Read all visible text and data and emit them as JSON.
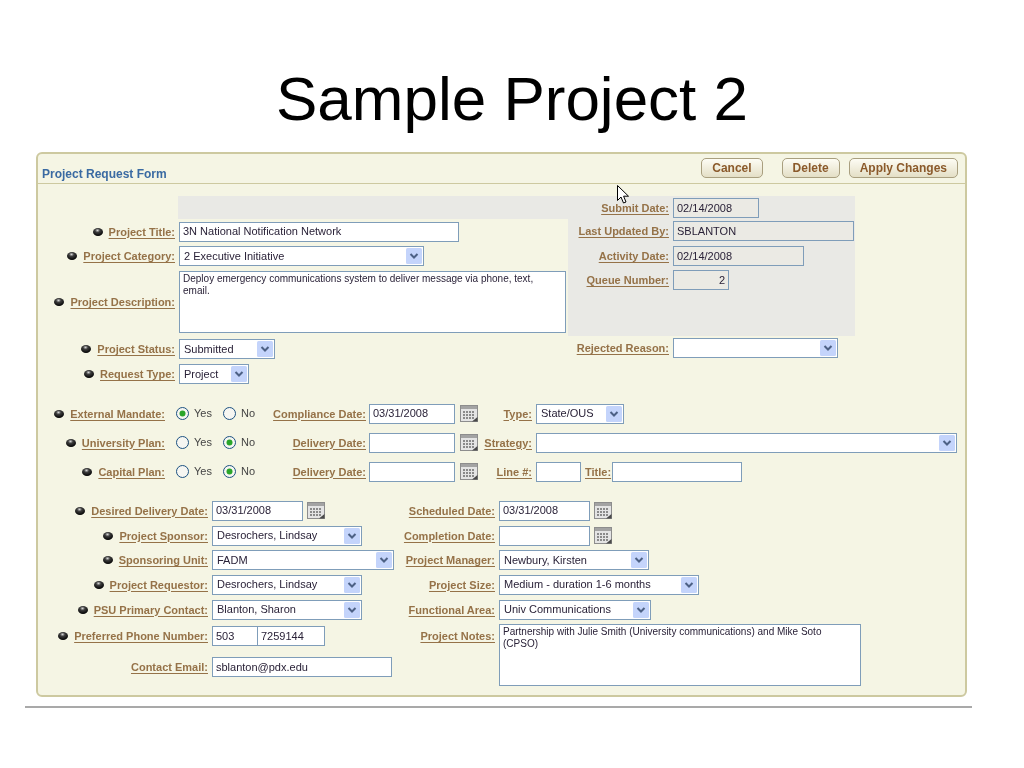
{
  "slide_title": "Sample Project 2",
  "form": {
    "title": "Project Request Form",
    "buttons": [
      "Cancel",
      "Delete",
      "Apply Changes"
    ],
    "project_fields": [
      {
        "label": "Project Title:",
        "kind": "text",
        "value": "3N National Notification Network",
        "required": true
      },
      {
        "label": "Project Category:",
        "kind": "select",
        "value": "2 Executive Initiative",
        "required": true
      },
      {
        "label": "Project Description:",
        "kind": "textarea",
        "value": "Deploy emergency communications system to deliver message via phone, text, email.",
        "required": true
      },
      {
        "label": "Project Status:",
        "kind": "select",
        "value": "Submitted",
        "required": true
      },
      {
        "label": "Request Type:",
        "kind": "select",
        "value": "Project",
        "required": true
      }
    ],
    "tracking_fields": [
      {
        "label": "Submit Date:",
        "kind": "text",
        "value": "02/14/2008",
        "readonly": true
      },
      {
        "label": "Last Updated By:",
        "kind": "text",
        "value": "SBLANTON",
        "readonly": true
      },
      {
        "label": "Activity Date:",
        "kind": "text",
        "value": "02/14/2008",
        "readonly": true
      },
      {
        "label": "Queue Number:",
        "kind": "number",
        "value": "2",
        "readonly": true
      },
      {
        "label": "Rejected Reason:",
        "kind": "select",
        "readonly": false
      }
    ],
    "plans": [
      {
        "label": "External Mandate:",
        "required": true,
        "options": [
          {
            "label": "Yes",
            "selected": true
          },
          {
            "label": "No",
            "selected": false
          }
        ],
        "date": {
          "label": "Compliance Date:",
          "value": "03/31/2008"
        },
        "extras": [
          {
            "label": "Type:",
            "kind": "select",
            "value": "State/OUS"
          }
        ]
      },
      {
        "label": "University Plan:",
        "required": true,
        "options": [
          {
            "label": "Yes",
            "selected": false
          },
          {
            "label": "No",
            "selected": true
          }
        ],
        "date": {
          "label": "Delivery Date:"
        },
        "extras": [
          {
            "label": "Strategy:",
            "kind": "select"
          }
        ]
      },
      {
        "label": "Capital Plan:",
        "required": true,
        "options": [
          {
            "label": "Yes",
            "selected": false
          },
          {
            "label": "No",
            "selected": true
          }
        ],
        "date": {
          "label": "Delivery Date:"
        },
        "extras": [
          {
            "label": "Line #:",
            "kind": "text"
          },
          {
            "label": "Title:",
            "kind": "text"
          }
        ]
      }
    ],
    "details_left": [
      {
        "label": "Desired Delivery Date:",
        "kind": "date",
        "value": "03/31/2008",
        "required": true
      },
      {
        "label": "Project Sponsor:",
        "kind": "select",
        "value": "Desrochers, Lindsay",
        "required": true
      },
      {
        "label": "Sponsoring Unit:",
        "kind": "select",
        "value": "FADM",
        "required": true
      },
      {
        "label": "Project Requestor:",
        "kind": "select",
        "value": "Desrochers, Lindsay",
        "required": true
      },
      {
        "label": "PSU Primary Contact:",
        "kind": "select",
        "value": "Blanton, Sharon",
        "required": true
      },
      {
        "label": "Preferred Phone Number:",
        "kind": "phone",
        "values": [
          "503",
          "7259144"
        ],
        "required": true
      },
      {
        "label": "Contact Email:",
        "kind": "text",
        "value": "sblanton@pdx.edu",
        "required": false
      }
    ],
    "details_right": [
      {
        "label": "Scheduled Date:",
        "kind": "date",
        "value": "03/31/2008"
      },
      {
        "label": "Completion Date:",
        "kind": "date"
      },
      {
        "label": "Project Manager:",
        "kind": "select",
        "value": "Newbury, Kirsten"
      },
      {
        "label": "Project Size:",
        "kind": "select",
        "value": "Medium - duration 1-6 months"
      },
      {
        "label": "Functional Area:",
        "kind": "select",
        "value": "Univ Communications"
      },
      {
        "label": "Project Notes:",
        "kind": "textarea",
        "value": "Partnership with Julie Smith (University communications) and Mike Soto (CPSO)"
      }
    ]
  }
}
